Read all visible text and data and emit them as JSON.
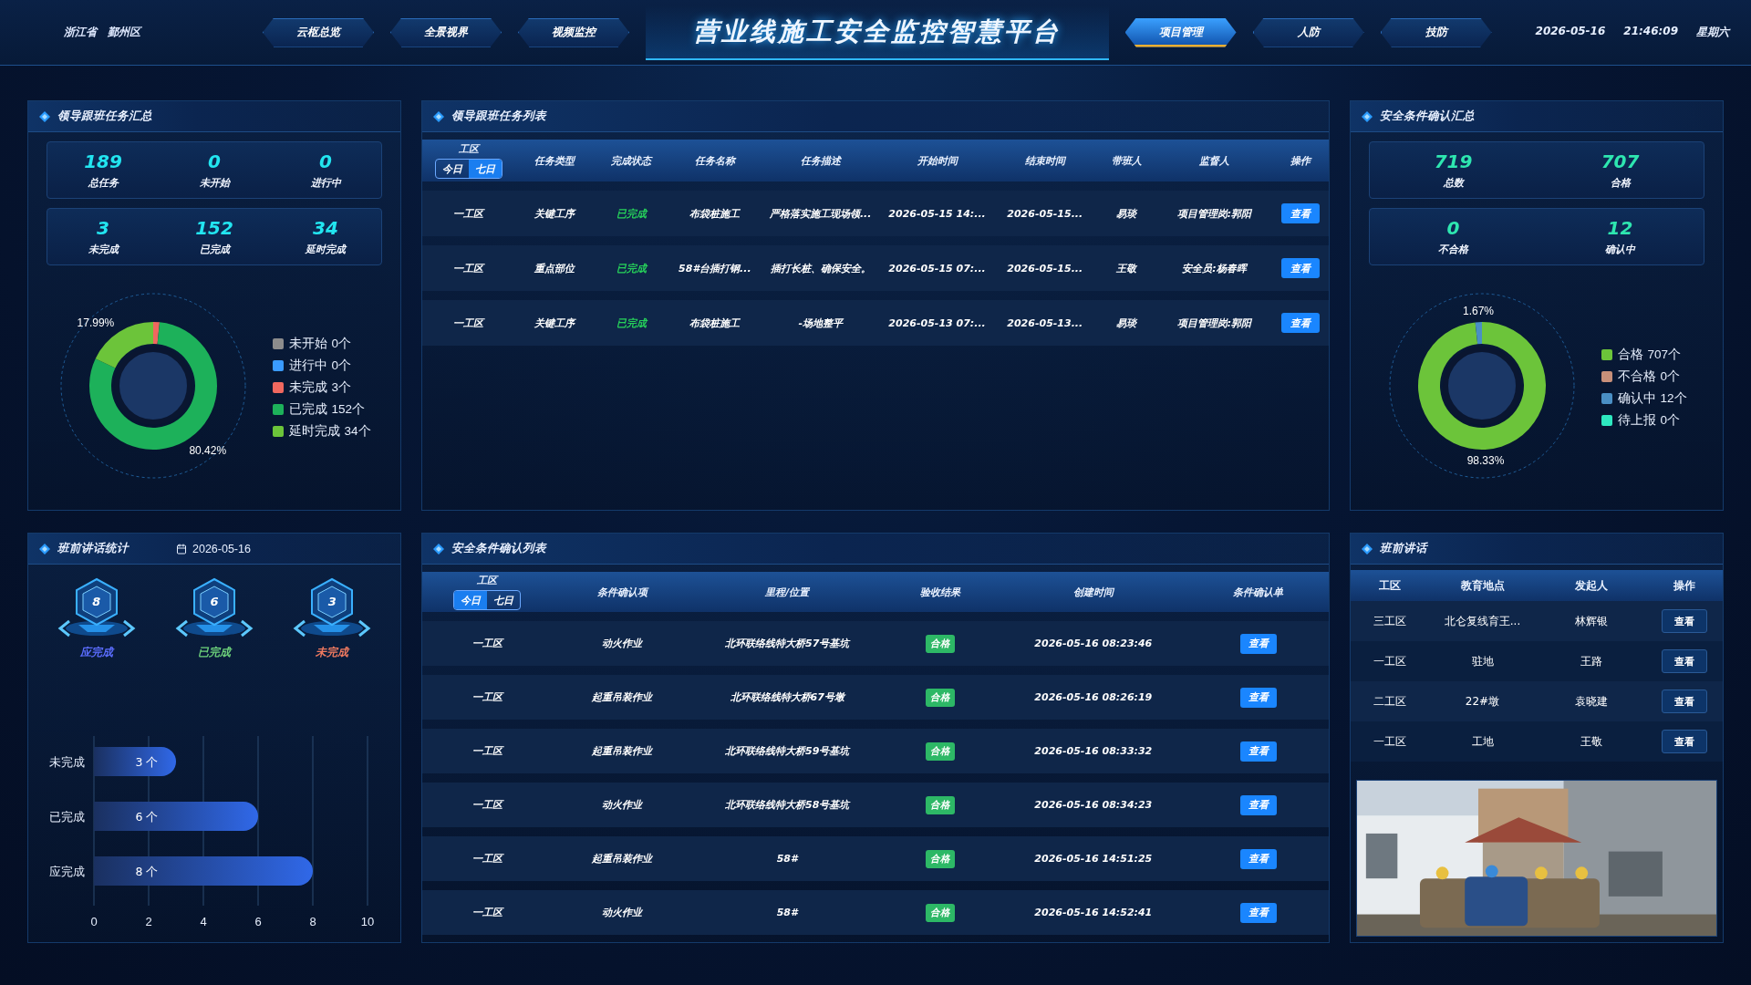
{
  "header": {
    "location": [
      "浙江省",
      "鄞州区"
    ],
    "nav_left": [
      {
        "label": "云枢总览",
        "selected": false
      },
      {
        "label": "全景视界",
        "selected": false
      },
      {
        "label": "视频监控",
        "selected": false
      }
    ],
    "title": "营业线施工安全监控智慧平台",
    "nav_right": [
      {
        "label": "项目管理",
        "selected": true
      },
      {
        "label": "人防",
        "selected": false
      },
      {
        "label": "技防",
        "selected": false
      }
    ],
    "date": "2026-05-16",
    "time": "21:46:09",
    "weekday": "星期六"
  },
  "task_summary": {
    "title": "领导跟班任务汇总",
    "stat_rows": [
      [
        {
          "value": "189",
          "label": "总任务"
        },
        {
          "value": "0",
          "label": "未开始"
        },
        {
          "value": "0",
          "label": "进行中"
        }
      ],
      [
        {
          "value": "3",
          "label": "未完成"
        },
        {
          "value": "152",
          "label": "已完成"
        },
        {
          "value": "34",
          "label": "延时完成"
        }
      ]
    ],
    "legend": [
      {
        "count": "0个",
        "color": "#8c8c8c"
      },
      {
        "count": "0个",
        "color": "#3a9bff"
      },
      {
        "count": "3个",
        "color": "#f0685f"
      },
      {
        "count": "152个",
        "color": "#1db15a"
      },
      {
        "count": "34个",
        "color": "#6cc43a"
      }
    ],
    "chart_data": {
      "type": "donut",
      "categories": [
        "未开始",
        "进行中",
        "未完成",
        "已完成",
        "延时完成"
      ],
      "values": [
        0,
        0,
        1.59,
        80.42,
        17.99
      ],
      "value_labels": [
        null,
        null,
        null,
        "80.42%",
        "17.99%"
      ]
    }
  },
  "task_list": {
    "title": "领导跟班任务列表",
    "columns": [
      {
        "label": "工区",
        "toggle": [
          {
            "label": "今日",
            "selected": false
          },
          {
            "label": "七日",
            "selected": true
          }
        ]
      },
      {
        "label": "任务类型"
      },
      {
        "label": "完成状态"
      },
      {
        "label": "任务名称"
      },
      {
        "label": "任务描述"
      },
      {
        "label": "开始时间"
      },
      {
        "label": "结束时间"
      },
      {
        "label": "带班人"
      },
      {
        "label": "监督人"
      },
      {
        "label": "操作"
      }
    ],
    "rows": [
      {
        "area": "一工区",
        "type": "关键工序",
        "status": "已完成",
        "name": "布袋桩施工",
        "description": "严格落实施工现场领...",
        "start": "2026-05-15 14:...",
        "end": "2026-05-15...",
        "leader": "易琰",
        "supervisor": "项目管理岗:郭阳",
        "action": "查看"
      },
      {
        "area": "一工区",
        "type": "重点部位",
        "status": "已完成",
        "name": "58#台插打钢...",
        "description": "插打长桩、确保安全。",
        "start": "2026-05-15 07:...",
        "end": "2026-05-15...",
        "leader": "王敬",
        "supervisor": "安全员:杨春晖",
        "action": "查看"
      },
      {
        "area": "一工区",
        "type": "关键工序",
        "status": "已完成",
        "name": "布袋桩施工",
        "description": "-场地整平",
        "start": "2026-05-13 07:...",
        "end": "2026-05-13...",
        "leader": "易琰",
        "supervisor": "项目管理岗:郭阳",
        "action": "查看"
      }
    ]
  },
  "safety_summary": {
    "title": "安全条件确认汇总",
    "stat_rows": [
      [
        {
          "value": "719",
          "label": "总数"
        },
        {
          "value": "707",
          "label": "合格"
        }
      ],
      [
        {
          "value": "0",
          "label": "不合格"
        },
        {
          "value": "12",
          "label": "确认中"
        }
      ]
    ],
    "legend": [
      {
        "count": "707个",
        "color": "#6cc43a"
      },
      {
        "count": "0个",
        "color": "#c8907a"
      },
      {
        "count": "12个",
        "color": "#4a8fc4"
      },
      {
        "count": "0个",
        "color": "#2ee8c0"
      }
    ],
    "chart_data": {
      "type": "donut",
      "categories": [
        "合格",
        "不合格",
        "确认中",
        "待上报"
      ],
      "values": [
        98.33,
        0,
        1.67,
        0
      ],
      "value_labels": [
        "98.33%",
        null,
        "1.67%",
        null
      ]
    }
  },
  "briefing_stats": {
    "title": "班前讲话统计",
    "date": "2026-05-16",
    "badges": [
      {
        "value": "8",
        "label": "应完成",
        "color": "#5b6dff"
      },
      {
        "value": "6",
        "label": "已完成",
        "color": "#6cd07a"
      },
      {
        "value": "3",
        "label": "未完成",
        "color": "#f07a60"
      }
    ],
    "chart_data": {
      "type": "bar",
      "orientation": "horizontal",
      "grid": true,
      "categories": [
        "未完成",
        "已完成",
        "应完成"
      ],
      "values": [
        3,
        6,
        8
      ],
      "xlim": [
        0,
        10
      ],
      "xticks": [
        0,
        2,
        4,
        6,
        8,
        10
      ],
      "value_labels": [
        "3 个",
        "6 个",
        "8 个"
      ]
    }
  },
  "safety_list": {
    "title": "安全条件确认列表",
    "columns": [
      {
        "label": "工区",
        "toggle": [
          {
            "label": "今日",
            "selected": true
          },
          {
            "label": "七日",
            "selected": false
          }
        ]
      },
      {
        "label": "条件确认项"
      },
      {
        "label": "里程/位置"
      },
      {
        "label": "验收结果"
      },
      {
        "label": "创建时间"
      },
      {
        "label": "条件确认单"
      }
    ],
    "rows": [
      {
        "area": "一工区",
        "item": "动火作业",
        "location": "北环联络线特大桥57号基坑",
        "result": "合格",
        "created": "2026-05-16 08:23:46",
        "action": "查看"
      },
      {
        "area": "一工区",
        "item": "起重吊装作业",
        "location": "北环联络线特大桥67号墩",
        "result": "合格",
        "created": "2026-05-16 08:26:19",
        "action": "查看"
      },
      {
        "area": "一工区",
        "item": "起重吊装作业",
        "location": "北环联络线特大桥59号基坑",
        "result": "合格",
        "created": "2026-05-16 08:33:32",
        "action": "查看"
      },
      {
        "area": "一工区",
        "item": "动火作业",
        "location": "北环联络线特大桥58号基坑",
        "result": "合格",
        "created": "2026-05-16 08:34:23",
        "action": "查看"
      },
      {
        "area": "一工区",
        "item": "起重吊装作业",
        "location": "58#",
        "result": "合格",
        "created": "2026-05-16 14:51:25",
        "action": "查看"
      },
      {
        "area": "一工区",
        "item": "动火作业",
        "location": "58#",
        "result": "合格",
        "created": "2026-05-16 14:52:41",
        "action": "查看"
      }
    ]
  },
  "briefings": {
    "title": "班前讲话",
    "columns": [
      "工区",
      "教育地点",
      "发起人",
      "操作"
    ],
    "rows": [
      {
        "area": "三工区",
        "location": "北仑复线育王...",
        "initiator": "林辉银",
        "action": "查看"
      },
      {
        "area": "一工区",
        "location": "驻地",
        "initiator": "王路",
        "action": "查看"
      },
      {
        "area": "二工区",
        "location": "22#墩",
        "initiator": "袁晓建",
        "action": "查看"
      },
      {
        "area": "一工区",
        "location": "工地",
        "initiator": "王敬",
        "action": "查看"
      }
    ],
    "photo": {
      "kind": "picture"
    }
  }
}
